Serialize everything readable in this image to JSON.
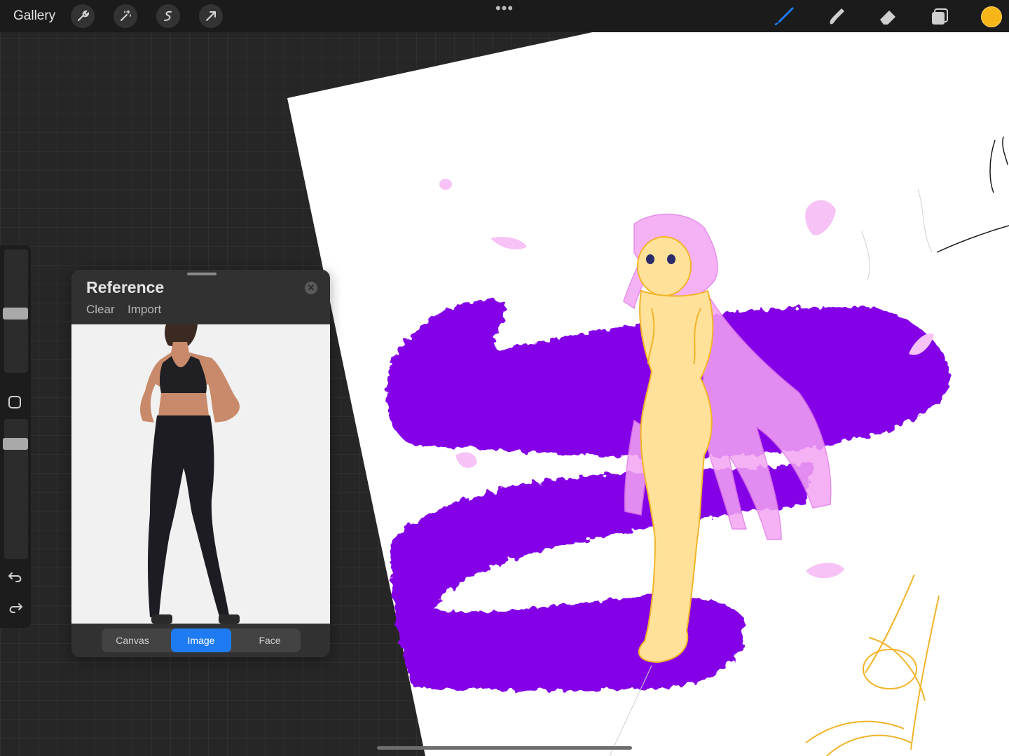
{
  "topbar": {
    "gallery_label": "Gallery",
    "left_tools": [
      "wrench-icon",
      "magic-wand-icon",
      "selection-icon",
      "transform-arrow-icon"
    ],
    "more_label": "•••",
    "right_tools": [
      "brush-icon",
      "smudge-icon",
      "eraser-icon",
      "layers-icon"
    ],
    "current_color": "#F7B618"
  },
  "sidebar": {
    "brush_size_level": 0.48,
    "opacity_level": 0.15
  },
  "reference": {
    "title": "Reference",
    "clear_label": "Clear",
    "import_label": "Import",
    "close_glyph": "✕",
    "tabs": [
      {
        "label": "Canvas",
        "active": false
      },
      {
        "label": "Image",
        "active": true
      },
      {
        "label": "Face",
        "active": false
      }
    ]
  },
  "colors": {
    "accent": "#1F7BF2",
    "paint_purple": "#8400E6",
    "skin": "#FFE19A",
    "hair_pink": "#F3A4F3"
  }
}
